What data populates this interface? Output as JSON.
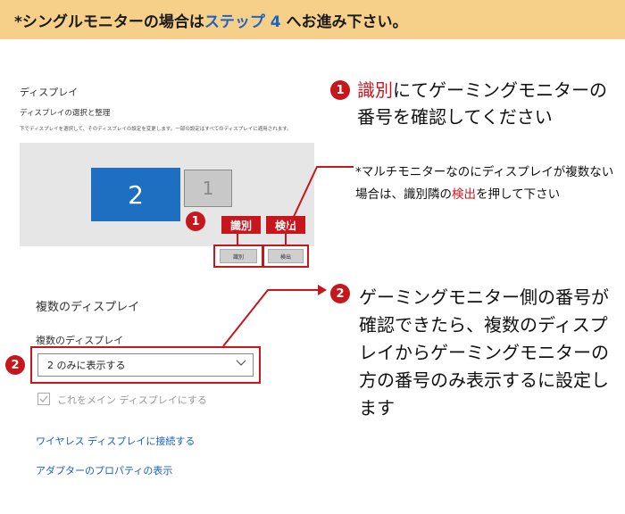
{
  "banner": {
    "part1": "*シングルモニターの場合は",
    "part2": "ステップ 4",
    "part3": " へお進み下さい。"
  },
  "settings": {
    "title": "ディスプレイ",
    "subtitle": "ディスプレイの選択と整理",
    "description": "下でディスプレイを選択して、そのディスプレイの設定を変更します。一部の設定はすべてのディスプレイに適用されます。",
    "monitor1": "2",
    "monitor2": "1",
    "identify_button": "識別",
    "detect_button": "検出",
    "multi_title": "複数のディスプレイ",
    "multi_label": "複数のディスプレイ",
    "multi_value": "2 のみに表示する",
    "main_display_checkbox": "これをメイン ディスプレイにする",
    "link_wireless": "ワイヤレス ディスプレイに接続する",
    "link_adapter": "アダプターのプロパティの表示"
  },
  "tags": {
    "identify": "識別",
    "detect": "検出"
  },
  "markers": {
    "one": "1",
    "two": "2"
  },
  "callout1": {
    "red": "識別",
    "rest": "にてゲーミングモニターの番号を確認してください"
  },
  "note": {
    "part1": "*マルチモニターなのにディスプレイが複数ない場合は、識別隣の",
    "red": "検出",
    "part2": "を押して下さい"
  },
  "callout2": {
    "text": "ゲーミングモニター側の番号が確認できたら、複数のディスプレイからゲーミングモニターの方の番号のみ表示するに設定します"
  },
  "colors": {
    "banner_bg": "#f6d089",
    "accent_red": "#c8161d",
    "highlight_blue": "#1f63c4",
    "monitor_blue": "#1e6fc1"
  },
  "icons": {
    "dropdown": "chevron-down-icon",
    "checkbox": "checkmark-icon"
  }
}
